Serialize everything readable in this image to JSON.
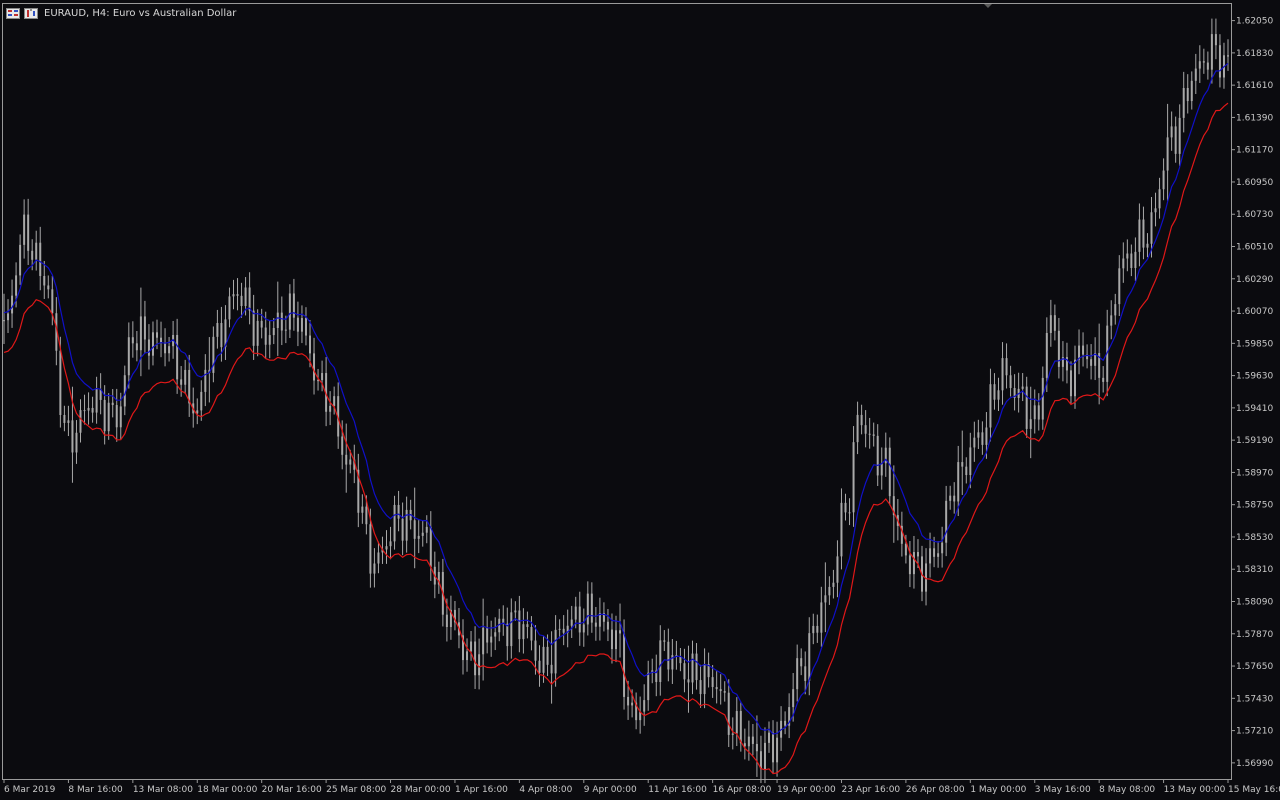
{
  "header": {
    "symbol": "EURAUD",
    "timeframe": "H4",
    "description": "Euro vs Australian Dollar",
    "title": "EURAUD, H4:  Euro vs Australian Dollar",
    "icons": [
      "chart-grid-icon",
      "chart-bars-icon"
    ]
  },
  "colors": {
    "background": "#0b0b0f",
    "candle": "#a9a9a9",
    "axis": "#c8c8c8",
    "blue_band": "#1010c8",
    "red_band": "#e01818"
  },
  "chart_data": {
    "type": "line",
    "subtype": "ohlc-bars-with-two-bands",
    "ylim": [
      1.5688,
      1.6217
    ],
    "y_ticks": [
      1.6205,
      1.6183,
      1.6161,
      1.6139,
      1.6117,
      1.6095,
      1.6073,
      1.6051,
      1.6029,
      1.6007,
      1.5985,
      1.5963,
      1.5941,
      1.5919,
      1.5897,
      1.5875,
      1.5853,
      1.5831,
      1.5809,
      1.5787,
      1.5765,
      1.5743,
      1.5721,
      1.5699
    ],
    "y_tick_labels": [
      "1.62050",
      "1.61830",
      "1.61610",
      "1.61390",
      "1.61170",
      "1.60950",
      "1.60730",
      "1.60510",
      "1.60290",
      "1.60070",
      "1.59850",
      "1.59630",
      "1.59410",
      "1.59190",
      "1.58970",
      "1.58750",
      "1.58530",
      "1.58310",
      "1.58090",
      "1.57870",
      "1.57650",
      "1.57430",
      "1.57210",
      "1.56990"
    ],
    "x_tick_labels": [
      "6 Mar 2019",
      "8 Mar 16:00",
      "13 Mar 08:00",
      "18 Mar 00:00",
      "20 Mar 16:00",
      "25 Mar 08:00",
      "28 Mar 00:00",
      "1 Apr 16:00",
      "4 Apr 08:00",
      "9 Apr 00:00",
      "11 Apr 16:00",
      "16 Apr 08:00",
      "19 Apr 00:00",
      "23 Apr 16:00",
      "26 Apr 08:00",
      "1 May 00:00",
      "3 May 16:00",
      "8 May 08:00",
      "13 May 00:00",
      "15 May 16:00"
    ],
    "x_tick_bar_index": [
      0,
      16,
      32,
      48,
      64,
      80,
      96,
      112,
      128,
      144,
      160,
      176,
      192,
      208,
      224,
      240,
      256,
      272,
      288,
      304
    ],
    "bar_count": 305,
    "anchors_close": [
      [
        0,
        1.5995
      ],
      [
        5,
        1.606
      ],
      [
        10,
        1.603
      ],
      [
        16,
        1.592
      ],
      [
        22,
        1.5945
      ],
      [
        28,
        1.5935
      ],
      [
        32,
        1.599
      ],
      [
        40,
        1.5985
      ],
      [
        48,
        1.594
      ],
      [
        52,
        1.5985
      ],
      [
        58,
        1.602
      ],
      [
        64,
        1.599
      ],
      [
        72,
        1.6005
      ],
      [
        80,
        1.595
      ],
      [
        86,
        1.59
      ],
      [
        92,
        1.5835
      ],
      [
        98,
        1.5865
      ],
      [
        104,
        1.5855
      ],
      [
        110,
        1.58
      ],
      [
        116,
        1.577
      ],
      [
        122,
        1.579
      ],
      [
        128,
        1.5795
      ],
      [
        134,
        1.5765
      ],
      [
        140,
        1.5795
      ],
      [
        146,
        1.58
      ],
      [
        152,
        1.5785
      ],
      [
        156,
        1.573
      ],
      [
        164,
        1.5775
      ],
      [
        170,
        1.576
      ],
      [
        176,
        1.5755
      ],
      [
        182,
        1.572
      ],
      [
        188,
        1.5705
      ],
      [
        192,
        1.5715
      ],
      [
        198,
        1.5765
      ],
      [
        204,
        1.581
      ],
      [
        210,
        1.588
      ],
      [
        212,
        1.5935
      ],
      [
        218,
        1.5905
      ],
      [
        224,
        1.584
      ],
      [
        228,
        1.583
      ],
      [
        232,
        1.5845
      ],
      [
        236,
        1.589
      ],
      [
        242,
        1.592
      ],
      [
        248,
        1.5965
      ],
      [
        252,
        1.595
      ],
      [
        256,
        1.593
      ],
      [
        260,
        1.6
      ],
      [
        264,
        1.596
      ],
      [
        268,
        1.598
      ],
      [
        272,
        1.5965
      ],
      [
        278,
        1.604
      ],
      [
        284,
        1.606
      ],
      [
        290,
        1.6125
      ],
      [
        296,
        1.617
      ],
      [
        300,
        1.6185
      ],
      [
        304,
        1.6175
      ]
    ],
    "series": [
      {
        "name": "",
        "color": "#1010c8",
        "role": "upper band",
        "offset": 0.0005
      },
      {
        "name": "",
        "color": "#e01818",
        "role": "lower band",
        "offset": -0.0022
      }
    ],
    "grid": false,
    "legend": "none"
  }
}
